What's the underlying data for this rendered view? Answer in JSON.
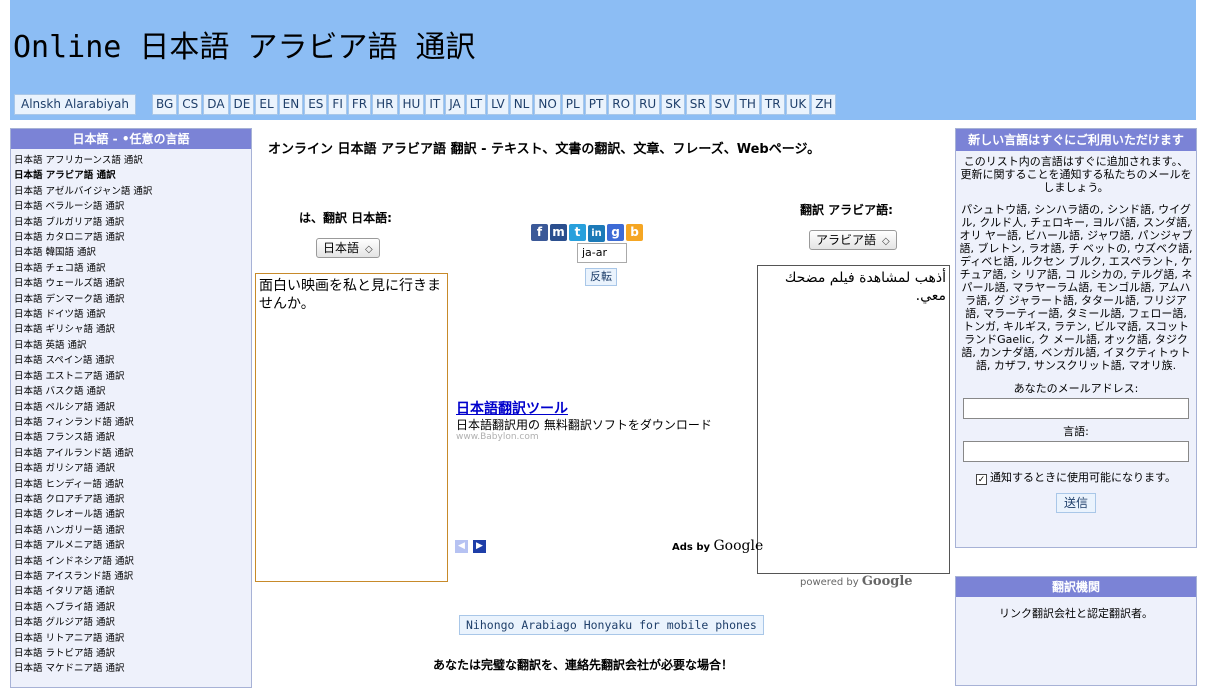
{
  "header": {
    "title": "Online 日本語 アラビア語 通訳",
    "home_label": "Alnskh Alarabiyah",
    "languages": [
      "BG",
      "CS",
      "DA",
      "DE",
      "EL",
      "EN",
      "ES",
      "FI",
      "FR",
      "HR",
      "HU",
      "IT",
      "JA",
      "LT",
      "LV",
      "NL",
      "NO",
      "PL",
      "PT",
      "RO",
      "RU",
      "SK",
      "SR",
      "SV",
      "TH",
      "TR",
      "UK",
      "ZH"
    ]
  },
  "left_panel": {
    "title": "日本語 - •任意の言語",
    "active_index": 1,
    "items": [
      "日本語 アフリカーンス語 通訳",
      "日本語 アラビア語 通訳",
      "日本語 アゼルバイジャン語 通訳",
      "日本語 ベラルーシ語 通訳",
      "日本語 ブルガリア語 通訳",
      "日本語 カタロニア語 通訳",
      "日本語 韓国語 通訳",
      "日本語 チェコ語 通訳",
      "日本語 ウェールズ語 通訳",
      "日本語 デンマーク語 通訳",
      "日本語 ドイツ語 通訳",
      "日本語 ギリシャ語 通訳",
      "日本語 英語 通訳",
      "日本語 スペイン語 通訳",
      "日本語 エストニア語 通訳",
      "日本語 バスク語 通訳",
      "日本語 ペルシア語 通訳",
      "日本語 フィンランド語 通訳",
      "日本語 フランス語 通訳",
      "日本語 アイルランド語 通訳",
      "日本語 ガリシア語 通訳",
      "日本語 ヒンディー語 通訳",
      "日本語 クロアチア語 通訳",
      "日本語 クレオール語 通訳",
      "日本語 ハンガリー語 通訳",
      "日本語 アルメニア語 通訳",
      "日本語 インドネシア語 通訳",
      "日本語 アイスランド語 通訳",
      "日本語 イタリア語 通訳",
      "日本語 ヘブライ語 通訳",
      "日本語 グルジア語 通訳",
      "日本語 リトアニア語 通訳",
      "日本語 ラトビア語 通訳",
      "日本語 マケドニア語 通訳"
    ]
  },
  "translator": {
    "heading": "オンライン 日本語 アラビア語 翻訳 - テキスト、文書の翻訳、文章、フレーズ、Webページ。",
    "source_label": "は、翻訳 日本語:",
    "source_select": "日本語",
    "target_label": "翻訳 アラビア語:",
    "target_select": "アラビア語",
    "source_text": "面白い映画を私と見に行きませんか。",
    "target_text": "أذهب لمشاهدة فيلم مضحك معي.",
    "lang_code": "ja-ar",
    "swap_label": "反転",
    "share_icons": [
      {
        "name": "facebook-icon",
        "glyph": "f",
        "color": "#3b5998"
      },
      {
        "name": "myspace-icon",
        "glyph": "m",
        "color": "#2b4f8e"
      },
      {
        "name": "technorati-icon",
        "glyph": "t",
        "color": "#28a0dc"
      },
      {
        "name": "linkedin-icon",
        "glyph": "in",
        "color": "#1c7ab8"
      },
      {
        "name": "google-icon",
        "glyph": "g",
        "color": "#3d6bd6"
      },
      {
        "name": "blogger-icon",
        "glyph": "b",
        "color": "#f5a623"
      }
    ]
  },
  "ad": {
    "link": "日本語翻訳ツール",
    "desc": "日本語翻訳用の 無料翻訳ソフトをダウンロード",
    "url": "www.Babylon.com",
    "ads_by": "Ads by",
    "google": "Google",
    "powered_by": "powered by"
  },
  "mobile_button": "Nihongo Arabiago Honyaku for mobile phones",
  "bottom_cta": "あなたは完璧な翻訳を、連絡先翻訳会社が必要な場合！",
  "notify_panel": {
    "title": "新しい言語はすぐにご利用いただけます",
    "intro": "このリスト内の言語はすぐに追加されます。、更新に関することを通知する私たちのメールをしましょう。",
    "languages": "パシュトウ語, シンハラ語の, シンド語, ウイグル, クルド人, チェロキー, ヨルバ語, スンダ語, オリ ヤー語, ビハール語, ジャワ語, パンジャブ語, ブレトン, ラオ語, チ ベットの, ウズベク語, ディベヒ語, ルクセン ブルク, エスペラント, ケチュア語, シ リア語, コ ルシカの, テルグ語, ネパール語, マラヤーラム語, モンゴル語, アムハラ語, グ ジャラート語, タタール語, フリジア語, マラーティー語, タミール語, フェロー語, トンガ, キルギス, ラテン, ビルマ語, スコットランドGaelic, ク メール語, オック語, タジク語, カンナダ語, ベンガル語, イヌクティトゥト語, カザフ, サンスクリット語, マオリ族.",
    "email_label": "あなたのメールアドレス:",
    "language_label": "言語:",
    "checkbox_label": "通知するときに使用可能になります。",
    "send_label": "送信"
  },
  "agency_panel": {
    "title": "翻訳機関",
    "text": "リンク翻訳会社と認定翻訳者。"
  }
}
